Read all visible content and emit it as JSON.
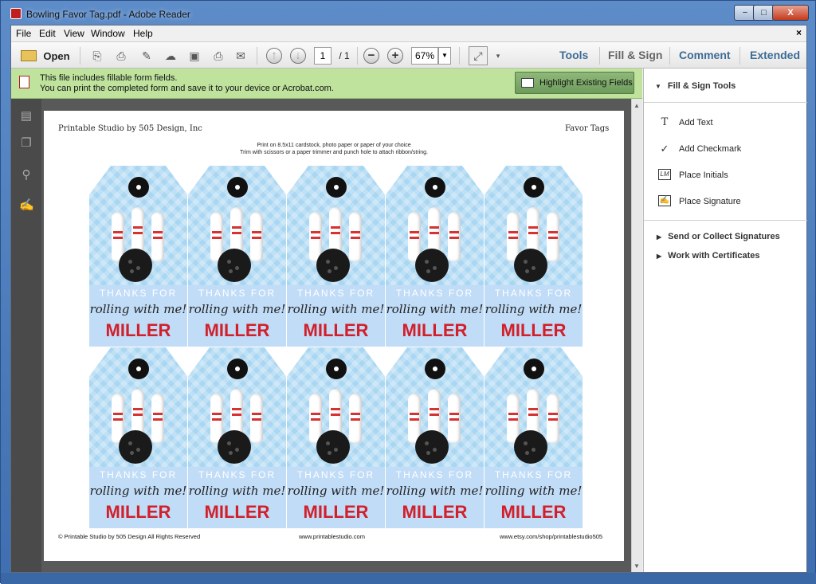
{
  "window": {
    "title": "Bowling Favor Tag.pdf - Adobe Reader",
    "min": "−",
    "max": "□",
    "close": "X"
  },
  "menu": {
    "items": [
      "File",
      "Edit",
      "View",
      "Window",
      "Help"
    ],
    "close": "×"
  },
  "toolbar": {
    "open_label": "Open",
    "page_current": "1",
    "page_total": "/ 1",
    "zoom": "67%",
    "tabs": [
      "Tools",
      "Fill & Sign",
      "Comment",
      "Extended"
    ]
  },
  "infobar": {
    "line1": "This file includes fillable form fields.",
    "line2": "You can print the completed form and save it to your device or Acrobat.com.",
    "button": "Highlight Existing Fields"
  },
  "page": {
    "header_left": "Printable Studio by 505 Design, Inc",
    "header_right": "Favor Tags",
    "instr1": "Print on 8.5x11 cardstock, photo paper or paper of your choice",
    "instr2": "Trim with scissors or a paper trimmer and punch hole to attach ribbon/string.",
    "tags": [
      {
        "thanks": "THANKS FOR",
        "line": "rolling with me!",
        "name": "MILLER"
      },
      {
        "thanks": "THANKS FOR",
        "line": "rolling with me!",
        "name": "MILLER"
      },
      {
        "thanks": "THANKS FOR",
        "line": "rolling with me!",
        "name": "MILLER"
      },
      {
        "thanks": "THANKS FOR",
        "line": "rolling with me!",
        "name": "MILLER"
      },
      {
        "thanks": "THANKS FOR",
        "line": "rolling with me!",
        "name": "MILLER"
      },
      {
        "thanks": "THANKS FOR",
        "line": "rolling with me!",
        "name": "MILLER"
      },
      {
        "thanks": "THANKS FOR",
        "line": "rolling with me!",
        "name": "MILLER"
      },
      {
        "thanks": "THANKS FOR",
        "line": "rolling with me!",
        "name": "MILLER"
      },
      {
        "thanks": "THANKS FOR",
        "line": "rolling with me!",
        "name": "MILLER"
      },
      {
        "thanks": "THANKS FOR",
        "line": "rolling with me!",
        "name": "MILLER"
      }
    ],
    "footer_left": "© Printable Studio by 505 Design All Rights Reserved",
    "footer_center": "www.printablestudio.com",
    "footer_right": "www.etsy.com/shop/printablestudio505"
  },
  "panel": {
    "section": "Fill & Sign Tools",
    "tools": [
      {
        "icon": "T",
        "label": "Add Text"
      },
      {
        "icon": "✓",
        "label": "Add Checkmark"
      },
      {
        "icon": "LM",
        "label": "Place Initials"
      },
      {
        "icon": "✍",
        "label": "Place Signature"
      }
    ],
    "collapsed": [
      "Send or Collect Signatures",
      "Work with Certificates"
    ]
  },
  "colors": {
    "accent": "#3d6c95",
    "infobar": "#bfe29d",
    "tag_blue": "#a9d6f2",
    "name_red": "#d21f2a"
  }
}
